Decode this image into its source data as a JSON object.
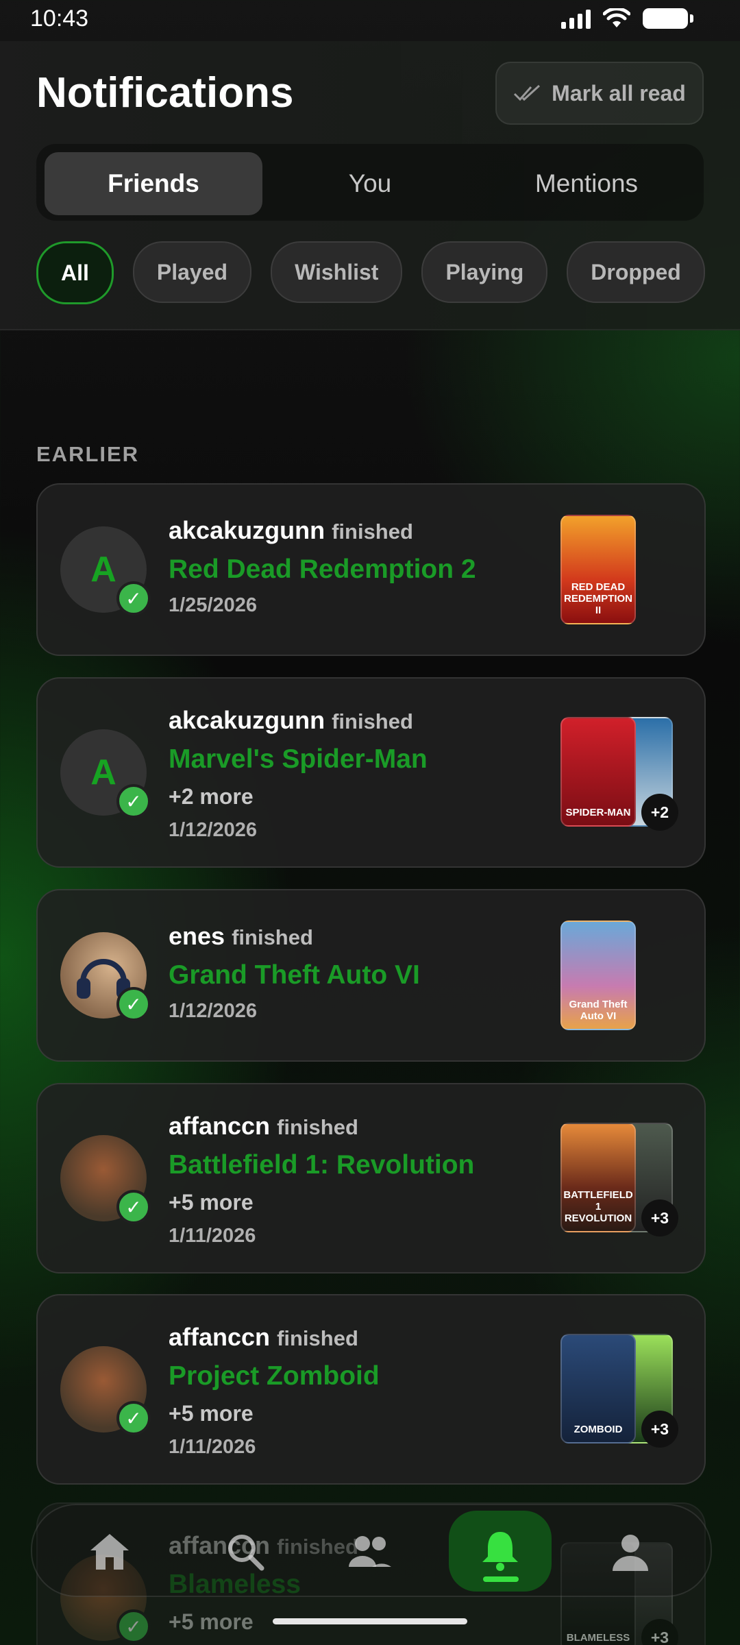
{
  "status_bar": {
    "time": "10:43"
  },
  "header": {
    "title": "Notifications",
    "mark_all_label": "Mark all read"
  },
  "tabs": [
    {
      "label": "Friends",
      "active": true
    },
    {
      "label": "You",
      "active": false
    },
    {
      "label": "Mentions",
      "active": false
    }
  ],
  "filters": [
    {
      "label": "All",
      "active": true
    },
    {
      "label": "Played",
      "active": false
    },
    {
      "label": "Wishlist",
      "active": false
    },
    {
      "label": "Playing",
      "active": false
    },
    {
      "label": "Dropped",
      "active": false
    }
  ],
  "section_label": "EARLIER",
  "notifications": [
    {
      "user": "akcakuzgunn",
      "verb": "finished",
      "game": "Red Dead Redemption 2",
      "more": "",
      "date": "1/25/2026",
      "avatar_letter": "A",
      "cover_text": "RED DEAD REDEMPTION II",
      "extra_count": ""
    },
    {
      "user": "akcakuzgunn",
      "verb": "finished",
      "game": "Marvel's Spider-Man",
      "more": "+2 more",
      "date": "1/12/2026",
      "avatar_letter": "A",
      "cover_text": "SPIDER-MAN",
      "extra_count": "+2"
    },
    {
      "user": "enes",
      "verb": "finished",
      "game": "Grand Theft Auto VI",
      "more": "",
      "date": "1/12/2026",
      "avatar_letter": "",
      "cover_text": "Grand Theft Auto VI",
      "extra_count": ""
    },
    {
      "user": "affanccn",
      "verb": "finished",
      "game": "Battlefield 1: Revolution",
      "more": "+5 more",
      "date": "1/11/2026",
      "avatar_letter": "",
      "cover_text": "BATTLEFIELD 1 REVOLUTION",
      "extra_count": "+3"
    },
    {
      "user": "affanccn",
      "verb": "finished",
      "game": "Project Zomboid",
      "more": "+5 more",
      "date": "1/11/2026",
      "avatar_letter": "",
      "cover_text": "ZOMBOID",
      "extra_count": "+3"
    },
    {
      "user": "affanccn",
      "verb": "finished",
      "game": "Blameless",
      "more": "+5 more",
      "date": "",
      "avatar_letter": "",
      "cover_text": "BLAMELESS",
      "extra_count": "+3"
    }
  ],
  "nav": [
    {
      "icon": "home-icon"
    },
    {
      "icon": "search-icon"
    },
    {
      "icon": "friends-icon"
    },
    {
      "icon": "bell-icon",
      "active": true
    },
    {
      "icon": "profile-icon"
    }
  ],
  "colors": {
    "accent": "#1a9b27",
    "accent_bright": "#37e040",
    "check": "#3bb54a"
  }
}
